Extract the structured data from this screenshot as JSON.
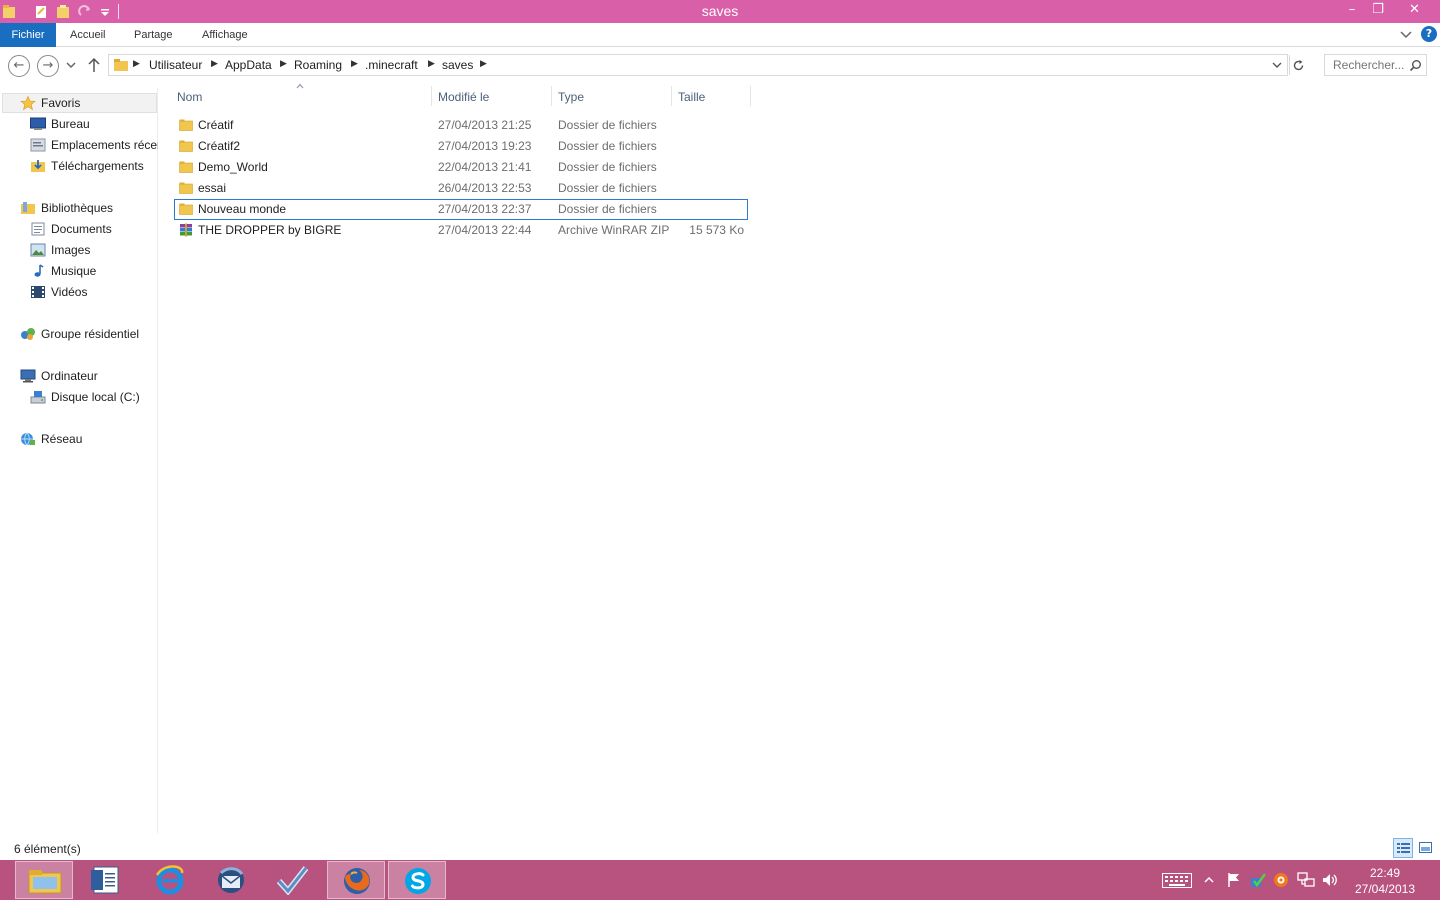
{
  "window": {
    "title": "saves",
    "minimize": "–",
    "restore": "❐",
    "close": "✕"
  },
  "ribbon": {
    "tabs": [
      {
        "label": "Fichier"
      },
      {
        "label": "Accueil"
      },
      {
        "label": "Partage"
      },
      {
        "label": "Affichage"
      }
    ],
    "help": "?"
  },
  "address": {
    "crumbs": [
      "Utilisateur",
      "AppData",
      "Roaming",
      ".minecraft",
      "saves"
    ]
  },
  "search": {
    "placeholder": "Rechercher..."
  },
  "navpane": {
    "items": [
      {
        "label": "Favoris",
        "icon": "star-icon"
      },
      {
        "label": "Bureau",
        "icon": "desktop-icon"
      },
      {
        "label": "Emplacements récents",
        "icon": "recent-places-icon"
      },
      {
        "label": "Téléchargements",
        "icon": "downloads-icon"
      },
      {
        "label": "Bibliothèques",
        "icon": "libraries-icon"
      },
      {
        "label": "Documents",
        "icon": "documents-icon"
      },
      {
        "label": "Images",
        "icon": "pictures-icon"
      },
      {
        "label": "Musique",
        "icon": "music-icon"
      },
      {
        "label": "Vidéos",
        "icon": "videos-icon"
      },
      {
        "label": "Groupe résidentiel",
        "icon": "homegroup-icon"
      },
      {
        "label": "Ordinateur",
        "icon": "computer-icon"
      },
      {
        "label": "Disque local (C:)",
        "icon": "drive-icon"
      },
      {
        "label": "Réseau",
        "icon": "network-icon"
      }
    ]
  },
  "columns": {
    "name": "Nom",
    "modified": "Modifié le",
    "type": "Type",
    "size": "Taille"
  },
  "files": [
    {
      "name": "Créatif",
      "modified": "27/04/2013 21:25",
      "type": "Dossier de fichiers",
      "size": "",
      "icon": "folder-icon"
    },
    {
      "name": "Créatif2",
      "modified": "27/04/2013 19:23",
      "type": "Dossier de fichiers",
      "size": "",
      "icon": "folder-icon"
    },
    {
      "name": "Demo_World",
      "modified": "22/04/2013 21:41",
      "type": "Dossier de fichiers",
      "size": "",
      "icon": "folder-icon"
    },
    {
      "name": "essai",
      "modified": "26/04/2013 22:53",
      "type": "Dossier de fichiers",
      "size": "",
      "icon": "folder-icon"
    },
    {
      "name": "Nouveau monde",
      "modified": "27/04/2013 22:37",
      "type": "Dossier de fichiers",
      "size": "",
      "icon": "folder-icon"
    },
    {
      "name": "THE DROPPER by BIGRE",
      "modified": "27/04/2013 22:44",
      "type": "Archive WinRAR ZIP",
      "size": "15 573 Ko",
      "icon": "winrar-archive-icon"
    }
  ],
  "status": {
    "count": "6 élément(s)"
  },
  "clock": {
    "time": "22:49",
    "date": "27/04/2013"
  },
  "colors": {
    "titlebar": "#d95fa8",
    "taskbar": "#b8527f",
    "file_tab": "#1a6ec0",
    "selection_border": "#2a7bd3",
    "folder": "#e8c24a"
  }
}
